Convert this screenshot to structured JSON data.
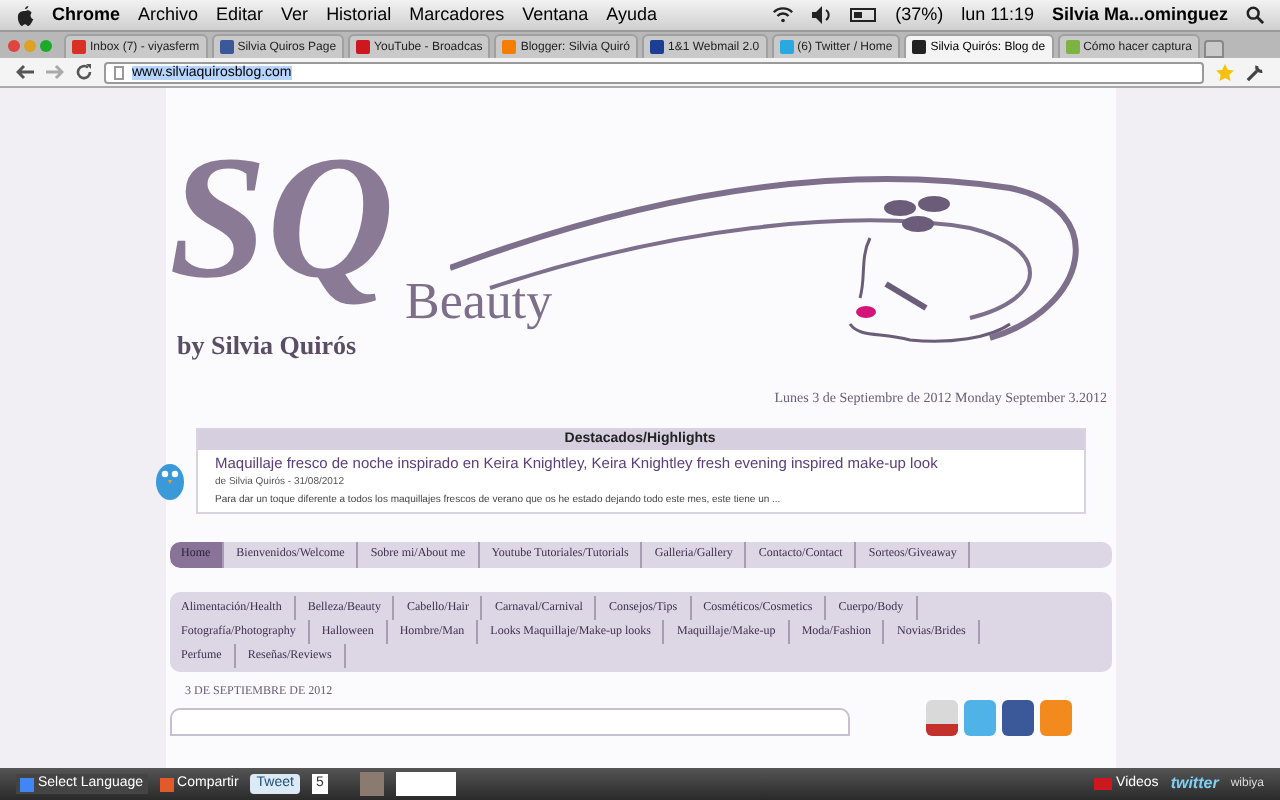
{
  "menubar": {
    "app": "Chrome",
    "menus": [
      "Archivo",
      "Editar",
      "Ver",
      "Historial",
      "Marcadores",
      "Ventana",
      "Ayuda"
    ],
    "battery": "(37%)",
    "clock": "lun 11:19",
    "user": "Silvia Ma...ominguez"
  },
  "tabs": [
    {
      "label": "Inbox (7) - viyasferm",
      "selected": false
    },
    {
      "label": "Silvia Quiros Page",
      "selected": false
    },
    {
      "label": "YouTube - Broadcas",
      "selected": false
    },
    {
      "label": "Blogger: Silvia Quiró",
      "selected": false
    },
    {
      "label": "1&1 Webmail 2.0",
      "selected": false
    },
    {
      "label": "(6) Twitter / Home",
      "selected": false
    },
    {
      "label": "Silvia Quirós: Blog de",
      "selected": true
    },
    {
      "label": "Cómo hacer captura",
      "selected": false
    }
  ],
  "address": {
    "url": "www.silviaquirosblog.com"
  },
  "logo": {
    "initials": "SQ",
    "word": "Beauty",
    "by": "by Silvia Quirós"
  },
  "date_line": "Lunes 3 de Septiembre de 2012 Monday September 3.2012",
  "highlights": {
    "title": "Destacados/Highlights",
    "post_title": "Maquillaje fresco de noche inspirado en Keira Knightley, Keira Knightley fresh evening inspired make-up look",
    "byline": "de Silvia Quirós - 31/08/2012",
    "snippet": "Para dar un toque diferente a todos los maquillajes frescos de verano que os he estado dejando todo este mes, este tiene un ..."
  },
  "nav": [
    {
      "label": "Home",
      "selected": true
    },
    {
      "label": "Bienvenidos/Welcome",
      "selected": false
    },
    {
      "label": "Sobre mi/About me",
      "selected": false
    },
    {
      "label": "Youtube Tutoriales/Tutorials",
      "selected": false
    },
    {
      "label": "Galleria/Gallery",
      "selected": false
    },
    {
      "label": "Contacto/Contact",
      "selected": false
    },
    {
      "label": "Sorteos/Giveaway",
      "selected": false
    }
  ],
  "categories": [
    [
      "Alimentación/Health",
      "Belleza/Beauty",
      "Cabello/Hair",
      "Carnaval/Carnival",
      "Consejos/Tips",
      "Cosméticos/Cosmetics",
      "Cuerpo/Body"
    ],
    [
      "Fotografía/Photography",
      "Halloween",
      "Hombre/Man",
      "Looks Maquillaje/Make-up looks",
      "Maquillaje/Make-up",
      "Moda/Fashion",
      "Novias/Brides"
    ],
    [
      "Perfume",
      "Reseñas/Reviews"
    ]
  ],
  "post_date": "3 DE SEPTIEMBRE DE 2012",
  "bottom_bar": {
    "language": "Select Language",
    "share": "Compartir",
    "tweet": "Tweet",
    "tweet_count": "5",
    "videos": "Videos",
    "twitter": "twitter",
    "powered": "wibiya"
  }
}
